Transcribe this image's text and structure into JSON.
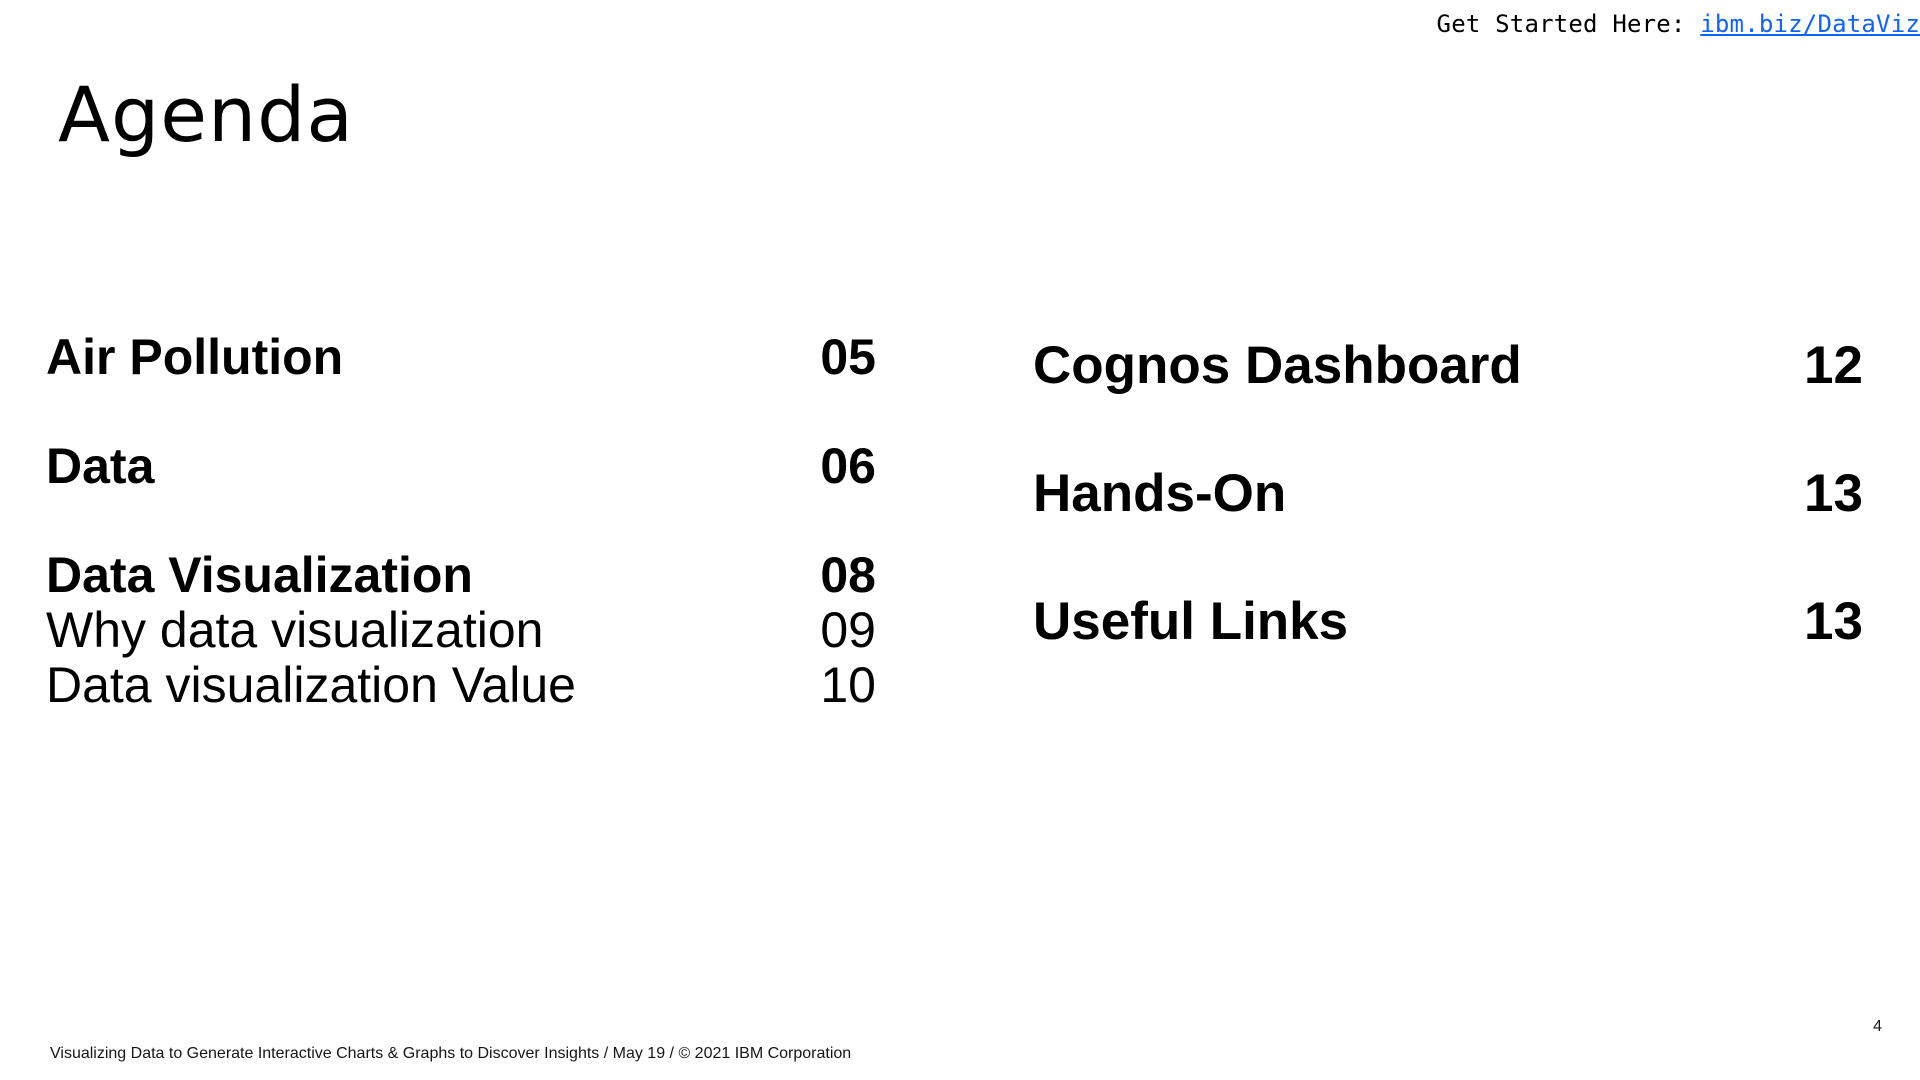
{
  "header": {
    "link_prefix": "Get Started Here:",
    "link_text": "ibm.biz/DataViz"
  },
  "title": "Agenda",
  "agenda": {
    "left": [
      {
        "label": "Air Pollution",
        "page": "05",
        "style": "main"
      },
      {
        "label": "Data",
        "page": "06",
        "style": "main"
      },
      {
        "label": "Data Visualization",
        "page": "08",
        "style": "main"
      },
      {
        "label": "Why data visualization",
        "page": "09",
        "style": "sub"
      },
      {
        "label": "Data visualization Value",
        "page": "10",
        "style": "sub"
      }
    ],
    "right": [
      {
        "label": "Cognos Dashboard",
        "page": "12",
        "style": "main"
      },
      {
        "label": "Hands-On",
        "page": "13",
        "style": "main"
      },
      {
        "label": "Useful Links",
        "page": "13",
        "style": "main"
      }
    ]
  },
  "footer": {
    "text": "Visualizing Data to Generate Interactive Charts & Graphs to Discover Insights / May 19 / © 2021 IBM Corporation",
    "page_number": "4"
  },
  "colors": {
    "link": "#0f62fe",
    "text": "#000000",
    "background": "#ffffff"
  }
}
